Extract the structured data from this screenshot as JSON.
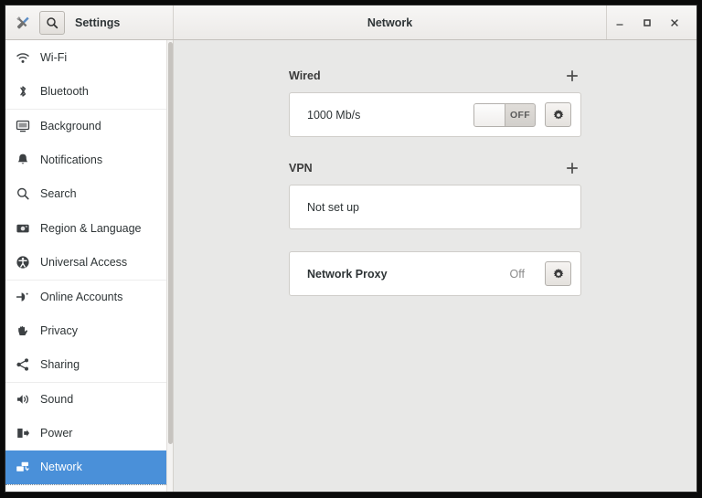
{
  "window": {
    "app_icon": "tools-icon",
    "sidebar_title": "Settings",
    "title": "Network",
    "search_icon": "search-icon",
    "controls": {
      "minimize": "–",
      "maximize": "□",
      "close": "×"
    }
  },
  "sidebar": {
    "items": [
      {
        "label": "Wi-Fi",
        "icon": "wifi-icon",
        "separator_above": false,
        "selected": false
      },
      {
        "label": "Bluetooth",
        "icon": "bluetooth-icon",
        "separator_above": false,
        "selected": false
      },
      {
        "label": "Background",
        "icon": "background-icon",
        "separator_above": true,
        "selected": false
      },
      {
        "label": "Notifications",
        "icon": "bell-icon",
        "separator_above": false,
        "selected": false
      },
      {
        "label": "Search",
        "icon": "search-icon",
        "separator_above": false,
        "selected": false
      },
      {
        "label": "Region & Language",
        "icon": "region-language-icon",
        "separator_above": false,
        "selected": false
      },
      {
        "label": "Universal Access",
        "icon": "universal-access-icon",
        "separator_above": false,
        "selected": false
      },
      {
        "label": "Online Accounts",
        "icon": "online-accounts-icon",
        "separator_above": true,
        "selected": false
      },
      {
        "label": "Privacy",
        "icon": "privacy-hand-icon",
        "separator_above": false,
        "selected": false
      },
      {
        "label": "Sharing",
        "icon": "sharing-icon",
        "separator_above": false,
        "selected": false
      },
      {
        "label": "Sound",
        "icon": "sound-icon",
        "separator_above": true,
        "selected": false
      },
      {
        "label": "Power",
        "icon": "power-icon",
        "separator_above": false,
        "selected": false
      },
      {
        "label": "Network",
        "icon": "network-icon",
        "separator_above": false,
        "selected": true
      }
    ],
    "selected_color": "#4a90d9"
  },
  "content": {
    "wired": {
      "title": "Wired",
      "add_icon": "plus-icon",
      "device_speed": "1000 Mb/s",
      "switch_state": "OFF",
      "settings_icon": "gear-icon"
    },
    "vpn": {
      "title": "VPN",
      "add_icon": "plus-icon",
      "status": "Not set up"
    },
    "proxy": {
      "title": "Network Proxy",
      "status": "Off",
      "settings_icon": "gear-icon"
    }
  }
}
